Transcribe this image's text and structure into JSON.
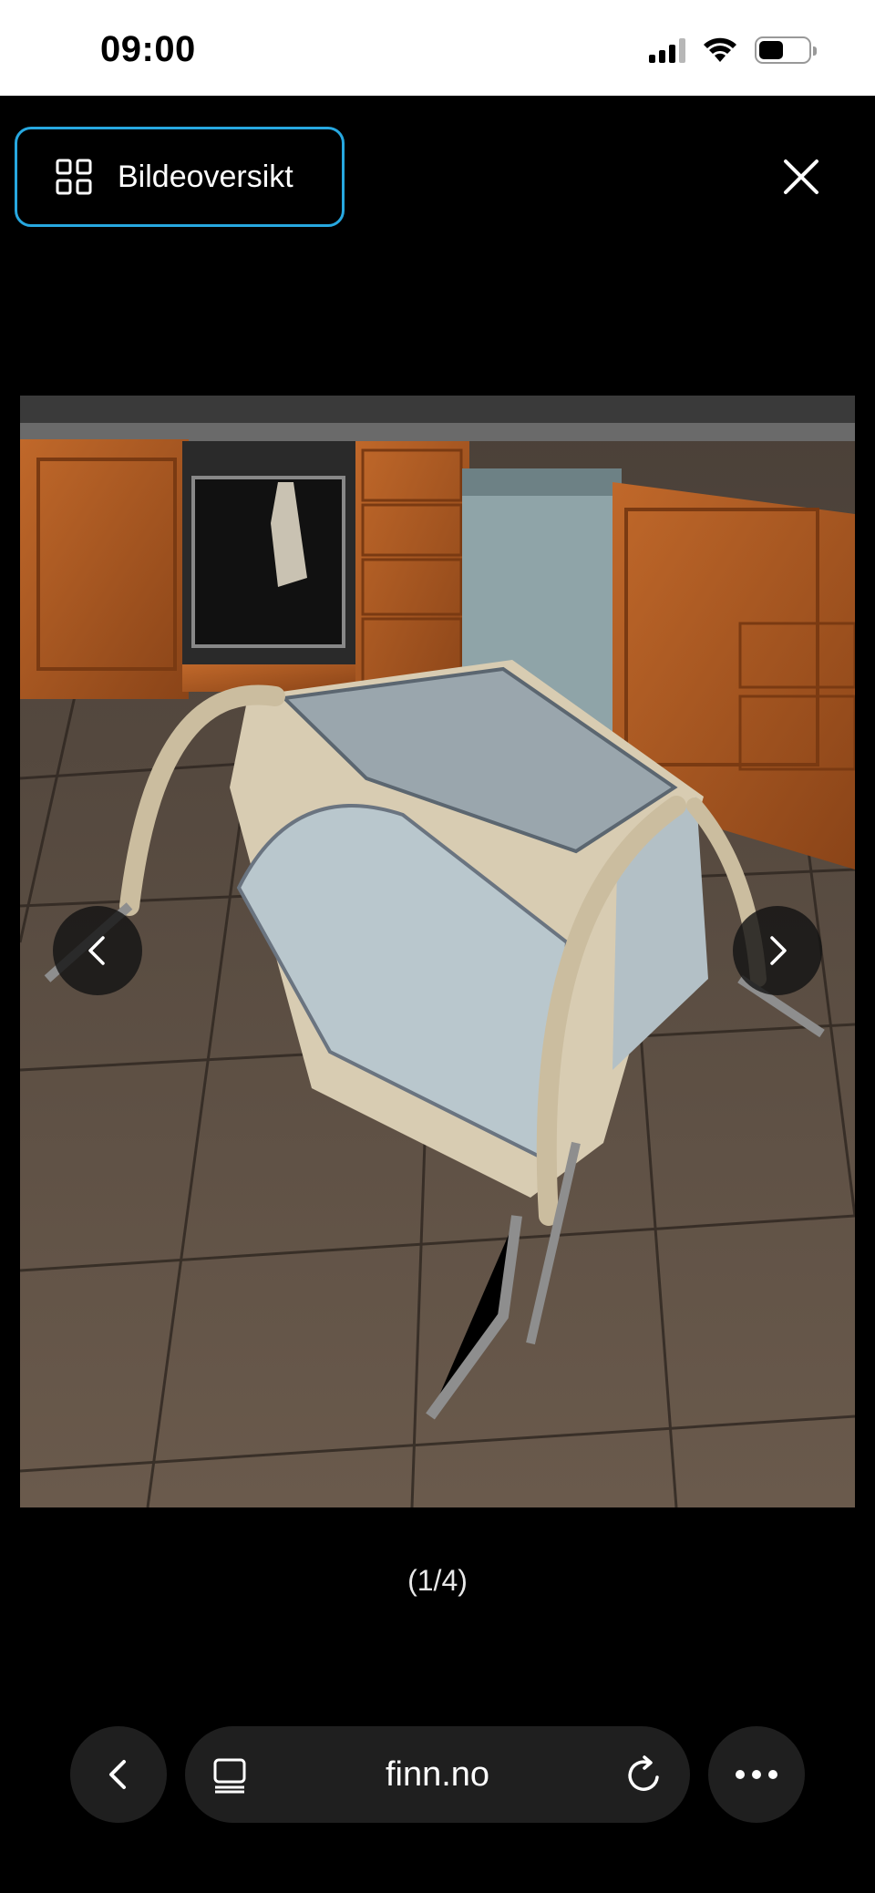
{
  "status_bar": {
    "time": "09:00",
    "icons": [
      "signal-icon",
      "wifi-icon",
      "battery-icon"
    ]
  },
  "viewer": {
    "overview_button_label": "Bildeoversikt",
    "overview_icon": "grid-icon",
    "close_icon": "close-icon",
    "counter": "(1/4)",
    "prev_icon": "chevron-left-icon",
    "next_icon": "chevron-right-icon",
    "image_alt": "Reiseseng / telt-barneseng satt opp på kjøkkengulv"
  },
  "browser": {
    "url": "finn.no",
    "back_icon": "chevron-left-icon",
    "tabs_icon": "tabs-icon",
    "reload_icon": "reload-icon",
    "more_icon": "more-icon"
  },
  "colors": {
    "accent_focus": "#27a8e0",
    "background": "#000000",
    "toolbar": "#1f1f1f"
  }
}
